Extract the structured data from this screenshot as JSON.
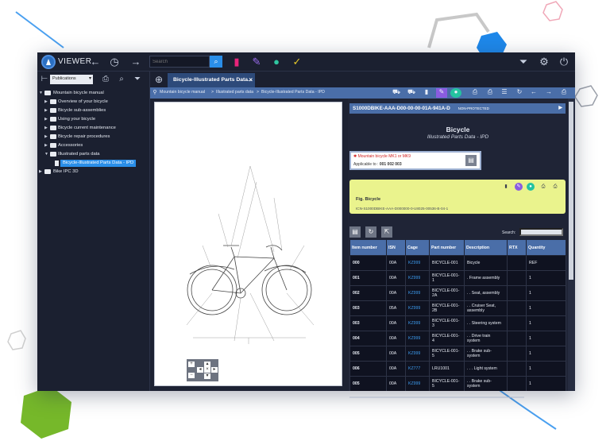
{
  "topbar": {
    "app_name": "VIEWER",
    "search_placeholder": "Search"
  },
  "sidebar": {
    "publication_select": "Publications",
    "tree": [
      {
        "label": "Mountain bicycle manual",
        "level": 0,
        "expanded": true
      },
      {
        "label": "Overview of your bicycle",
        "level": 1
      },
      {
        "label": "Bicycle sub-assemblies",
        "level": 1
      },
      {
        "label": "Using your bicycle",
        "level": 1
      },
      {
        "label": "Bicycle current maintenance",
        "level": 1
      },
      {
        "label": "Bicycle repair procedures",
        "level": 1
      },
      {
        "label": "Accessories",
        "level": 1
      },
      {
        "label": "Illustrated parts data",
        "level": 1,
        "expanded": true
      },
      {
        "label": "Bicycle-Illustrated Parts Data - IPD",
        "level": 2,
        "selected": true
      },
      {
        "label": "Bike IPC 3D",
        "level": 0
      }
    ]
  },
  "tab": {
    "title": "Bicycle-Illustrated Parts Data...",
    "close": "×"
  },
  "breadcrumb": {
    "items": [
      "Mountain bicycle manual",
      "Illustrated parts data",
      "Bicycle-Illustrated Parts Data - IPD"
    ],
    "separator": ">"
  },
  "document": {
    "dm_code": "S1000DBIKE-AAA-D00-00-00-01A-941A-D",
    "security": "NON-PROTECTED",
    "title": "Bicycle",
    "subtitle": "Illustrated Parts Data - IPD",
    "warning": "Mountain bicycle MK1 or MK9",
    "applicable_label": "Applicable to :",
    "applicable_values": "001  002  003",
    "figure_title": "Fig. Bicycle",
    "figure_icn": "ICN-S1000DBIKE-AAA-D000000-0-U8025-00536-B-04-1"
  },
  "table": {
    "search_label": "Search:",
    "columns": [
      "Item number",
      "ISN",
      "Cage",
      "Part number",
      "Description",
      "RTX",
      "Quantity"
    ],
    "rows": [
      [
        "000",
        "00A",
        "KZ999",
        "BICYCLE-001",
        "Bicycle",
        "",
        "REF"
      ],
      [
        "001",
        "00A",
        "KZ999",
        "BICYCLE-001-1",
        ". Frame assembly",
        "",
        "1"
      ],
      [
        "002",
        "00A",
        "KZ999",
        "BICYCLE-001-2A",
        ". . Seat, assembly",
        "",
        "1"
      ],
      [
        "003",
        "05A",
        "KZ999",
        "BICYCLE-001-2B",
        ". . Cruiser Seat, assembly",
        "",
        "1"
      ],
      [
        "003",
        "00A",
        "KZ999",
        "BICYCLE-001-3",
        ". . Steering system",
        "",
        "1"
      ],
      [
        "004",
        "00A",
        "KZ999",
        "BICYCLE-001-4",
        ". . Drive train system",
        "",
        "1"
      ],
      [
        "005",
        "00A",
        "KZ999",
        "BICYCLE-001-5",
        ". . Brake sub-system",
        "",
        "1"
      ],
      [
        "006",
        "00A",
        "KZ777",
        "LRU1001",
        ". . . Light system",
        "",
        "1"
      ],
      [
        "005",
        "00A",
        "KZ999",
        "BICYCLE-001-5",
        ". . Brake sub-system",
        "",
        "1"
      ]
    ]
  },
  "colors": {
    "accent_blue": "#2a8ee8",
    "header_blue": "#4a6ea8",
    "figure_bg": "#eaf38d",
    "app_bg": "#1d2233"
  }
}
